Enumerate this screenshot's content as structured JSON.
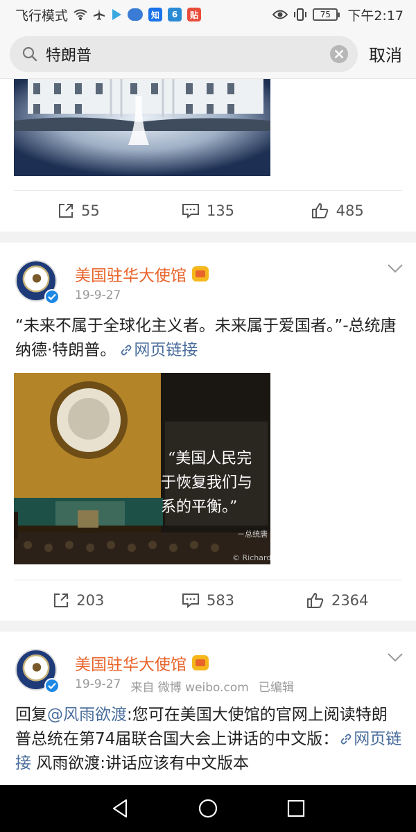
{
  "status_bar": {
    "left_text": "飞行模式",
    "battery": "75",
    "time": "下午2:17",
    "app_chips": [
      {
        "icon": "zhihu-icon",
        "text": "知",
        "color": "#1a73e8"
      },
      {
        "icon": "app-6-icon",
        "text": "6",
        "color": "#2a8ad4"
      },
      {
        "icon": "tieba-icon",
        "text": "贴",
        "color": "#e84d3b"
      }
    ]
  },
  "search": {
    "query": "特朗普",
    "cancel_label": "取消"
  },
  "posts": [
    {
      "actions": {
        "reposts": "55",
        "comments": "135",
        "likes": "485"
      }
    },
    {
      "user": "美国驻华大使馆",
      "date": "19-9-27",
      "text_main": "“未来不属于全球化主义者。未来属于爱国者。”-总统唐纳德·特朗普。",
      "link_label": "网页链接",
      "image_caption_lines": [
        "“美国人民完",
        "于恢复我们与",
        "系的平衡。”"
      ],
      "image_signature": "－总统唐",
      "image_credit": "© Richard",
      "actions": {
        "reposts": "203",
        "comments": "583",
        "likes": "2364"
      }
    },
    {
      "user": "美国驻华大使馆",
      "date": "19-9-27",
      "source": "来自 微博 weibo.com",
      "edited": "已编辑",
      "reply_prefix": "回复",
      "mention": "@风雨欲渡",
      "text_a": ":您可在美国大使馆的官网上阅读特朗普总统在第74届联合国大会上讲话的中文版：",
      "link_label": "网页链接",
      "text_b": " 风雨欲渡:讲话应该有中文版本"
    }
  ],
  "colors": {
    "accent_orange": "#e8642a",
    "link_blue": "#4a6d9c",
    "verified_blue": "#1e88e5"
  }
}
